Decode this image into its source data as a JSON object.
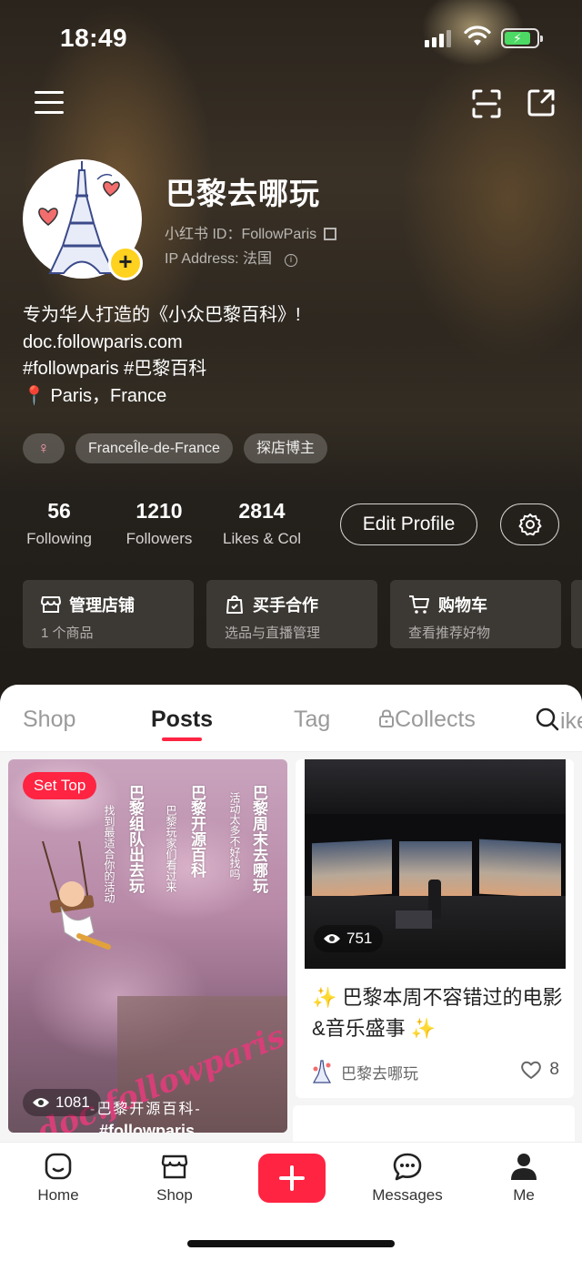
{
  "status_bar": {
    "time": "18:49"
  },
  "profile": {
    "name": "巴黎去哪玩",
    "id_line": "小红书 ID：FollowParis",
    "ip_line": "IP Address: 法国",
    "bio_lines": [
      "专为华人打造的《小众巴黎百科》!",
      "doc.followparis.com",
      "#followparis #巴黎百科",
      "📍 Paris，France"
    ],
    "tags": [
      "♀",
      "FranceÎle-de-France",
      "探店博主"
    ]
  },
  "stats": [
    {
      "value": "56",
      "label": "Following"
    },
    {
      "value": "1210",
      "label": "Followers"
    },
    {
      "value": "2814",
      "label": "Likes & Col"
    }
  ],
  "buttons": {
    "edit_profile": "Edit Profile"
  },
  "cards": [
    {
      "title": "管理店铺",
      "subtitle": "1 个商品",
      "icon": "store-icon"
    },
    {
      "title": "买手合作",
      "subtitle": "选品与直播管理",
      "icon": "bag-icon"
    },
    {
      "title": "购物车",
      "subtitle": "查看推荐好物",
      "icon": "cart-icon"
    }
  ],
  "tabs": [
    {
      "label": "Shop",
      "active": false
    },
    {
      "label": "Posts",
      "active": true
    },
    {
      "label": "Tag",
      "active": false
    },
    {
      "label": "Collects",
      "active": false,
      "icon": "lock-icon"
    },
    {
      "label": "ike",
      "active": false,
      "icon": "search-icon"
    }
  ],
  "posts": [
    {
      "badge": "Set Top",
      "views": "1081",
      "overlay": {
        "col1": "巴黎周末去哪玩",
        "col1_sub": "活动太多不好找吗",
        "col2": "巴黎开源百科",
        "col2_sub": "巴黎玩家们看过来",
        "col3": "巴黎组队出去玩",
        "col3_sub": "找到最适合你的活动",
        "watermark": "doc.followparis.com",
        "subtitle": "-巴黎开源百科-",
        "hashtag": "#followparis"
      }
    },
    {
      "views": "751",
      "title": "✨ 巴黎本周不容错过的电影&音乐盛事 ✨",
      "author": "巴黎去哪玩",
      "likes": "8"
    }
  ],
  "bottom_nav": [
    {
      "label": "Home",
      "icon": "home-icon"
    },
    {
      "label": "Shop",
      "icon": "shop-icon"
    },
    {
      "label": "",
      "icon": "plus-icon"
    },
    {
      "label": "Messages",
      "icon": "message-icon"
    },
    {
      "label": "Me",
      "icon": "person-icon"
    }
  ],
  "colors": {
    "accent": "#ff2442",
    "avatar_badge": "#ffd21f"
  }
}
